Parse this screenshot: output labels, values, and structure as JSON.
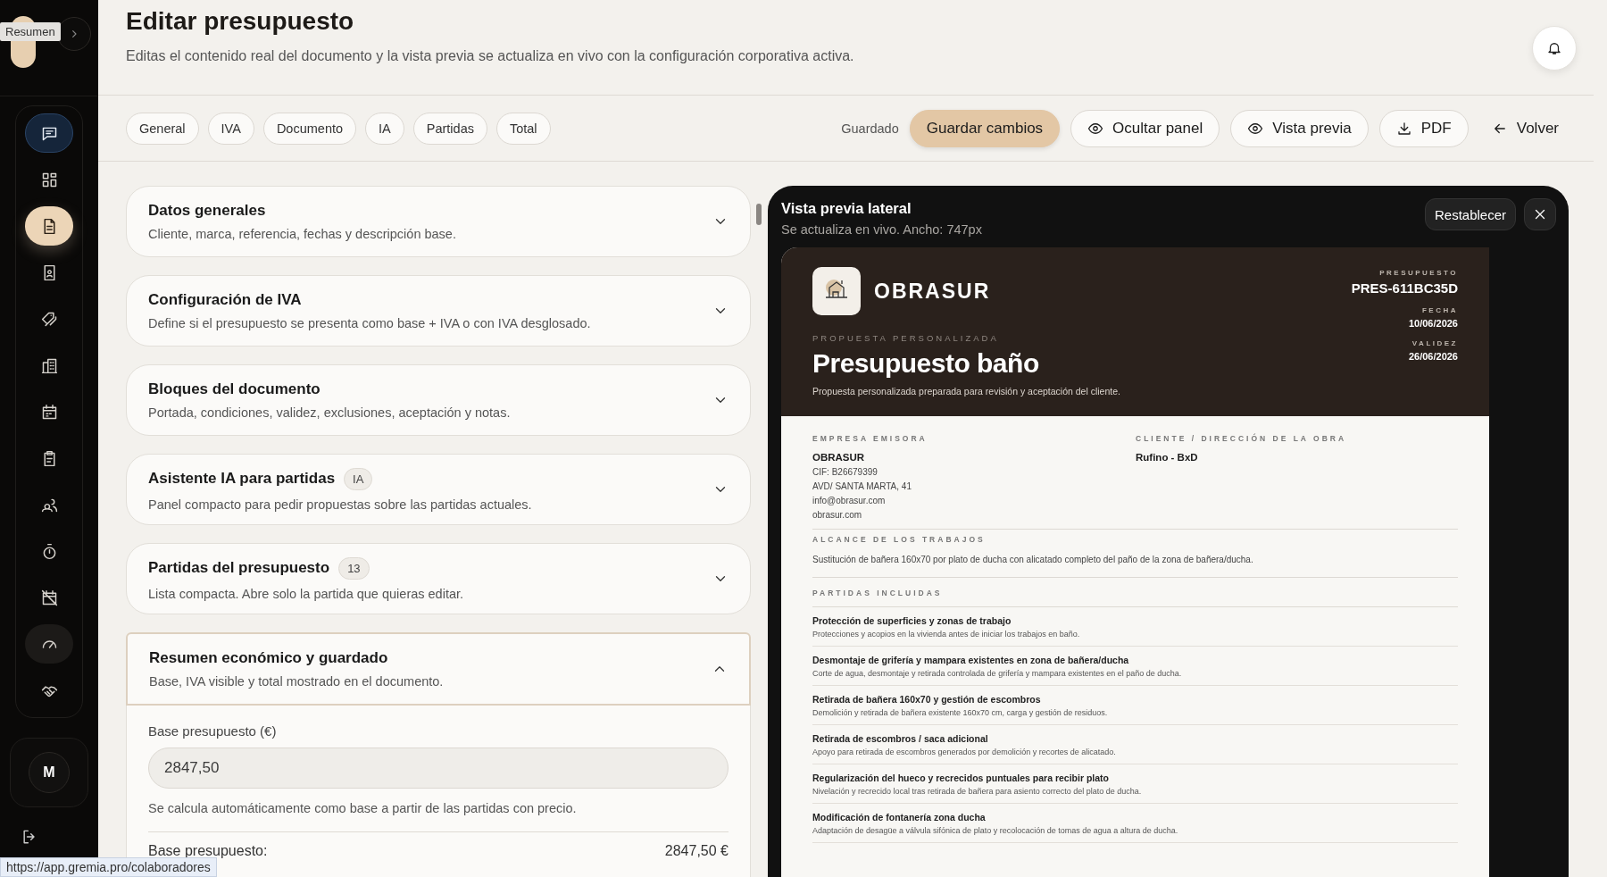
{
  "sidebar": {
    "tooltip": "Resumen",
    "nav": [
      {
        "selected": false,
        "active": true,
        "hovered": false
      },
      {
        "selected": false,
        "active": false,
        "hovered": false
      },
      {
        "selected": true,
        "active": false,
        "hovered": false
      },
      {
        "selected": false,
        "active": false,
        "hovered": false
      },
      {
        "selected": false,
        "active": false,
        "hovered": false
      },
      {
        "selected": false,
        "active": false,
        "hovered": false
      },
      {
        "selected": false,
        "active": false,
        "hovered": false
      },
      {
        "selected": false,
        "active": false,
        "hovered": false
      },
      {
        "selected": false,
        "active": false,
        "hovered": false
      },
      {
        "selected": false,
        "active": false,
        "hovered": false
      },
      {
        "selected": false,
        "active": false,
        "hovered": false
      },
      {
        "selected": false,
        "active": false,
        "hovered": true
      },
      {
        "selected": false,
        "active": false,
        "hovered": false
      }
    ],
    "avatar": "M"
  },
  "header": {
    "title": "Editar presupuesto",
    "subtitle": "Editas el contenido real del documento y la vista previa se actualiza en vivo con la configuración corporativa activa."
  },
  "section_tabs": [
    {
      "label": "General",
      "selected": false
    },
    {
      "label": "IVA",
      "selected": false
    },
    {
      "label": "Documento",
      "selected": false
    },
    {
      "label": "IA",
      "selected": false
    },
    {
      "label": "Partidas",
      "selected": false
    },
    {
      "label": "Total",
      "selected": false
    }
  ],
  "save_status": "Guardado",
  "actions": [
    {
      "label": "Guardar cambios",
      "kind": "primary"
    },
    {
      "label": "Ocultar panel",
      "kind": "eye"
    },
    {
      "label": "Vista previa",
      "kind": "eye"
    },
    {
      "label": "PDF",
      "kind": "download"
    },
    {
      "label": "Volver",
      "kind": "back"
    }
  ],
  "sections": [
    {
      "title": "Datos generales",
      "description": "Cliente, marca, referencia, fechas y descripción base.",
      "expanded": false
    },
    {
      "title": "Configuración de IVA",
      "description": "Define si el presupuesto se presenta como base + IVA o con IVA desglosado.",
      "expanded": false
    },
    {
      "title": "Bloques del documento",
      "description": "Portada, condiciones, validez, exclusiones, aceptación y notas.",
      "expanded": false
    },
    {
      "title": "Asistente IA para partidas",
      "badge": "IA",
      "description": "Panel compacto para pedir propuestas sobre las partidas actuales.",
      "expanded": false
    },
    {
      "title": "Partidas del presupuesto",
      "badge": "13",
      "description": "Lista compacta. Abre solo la partida que quieras editar.",
      "expanded": false
    },
    {
      "title": "Resumen económico y guardado",
      "description": "Base, IVA visible y total mostrado en el documento.",
      "expanded": true
    }
  ],
  "summary_form": {
    "field_label": "Base presupuesto (€)",
    "value": "2847,50",
    "help": "Se calcula automáticamente como base a partir de las partidas con precio.",
    "total_label": "Base presupuesto:",
    "total_value": "2847,50 €"
  },
  "preview": {
    "title": "Vista previa lateral",
    "subtitle": "Se actualiza en vivo. Ancho: 747px",
    "reset_label": "Restablecer",
    "document": {
      "company": "OBRASUR",
      "meta": [
        {
          "label": "PRESUPUESTO",
          "value": "PRES-611BC35D"
        },
        {
          "label": "FECHA",
          "value": "10/06/2026"
        },
        {
          "label": "VALIDEZ",
          "value": "26/06/2026"
        }
      ],
      "eyebrow": "PROPUESTA PERSONALIZADA",
      "title": "Presupuesto baño",
      "intro": "Propuesta personalizada preparada para revisión y aceptación del cliente.",
      "issuer": {
        "label": "EMPRESA EMISORA",
        "name": "OBRASUR",
        "lines": [
          "CIF: B26679399",
          "AVD/ SANTA MARTA, 41",
          "info@obrasur.com",
          "obrasur.com"
        ]
      },
      "client": {
        "label": "CLIENTE / DIRECCIÓN DE LA OBRA",
        "name": "Rufino - BxD"
      },
      "scope": {
        "label": "ALCANCE DE LOS TRABAJOS",
        "text": "Sustitución de bañera 160x70 por plato de ducha con alicatado completo del paño de la zona de bañera/ducha."
      },
      "items_label": "PARTIDAS INCLUIDAS",
      "items": [
        {
          "title": "Protección de superficies y zonas de trabajo",
          "description": "Protecciones y acopios en la vivienda antes de iniciar los trabajos en baño."
        },
        {
          "title": "Desmontaje de grifería y mampara existentes en zona de bañera/ducha",
          "description": "Corte de agua, desmontaje y retirada controlada de grifería y mampara existentes en el paño de ducha."
        },
        {
          "title": "Retirada de bañera 160x70 y gestión de escombros",
          "description": "Demolición y retirada de bañera existente 160x70 cm, carga y gestión de residuos."
        },
        {
          "title": "Retirada de escombros / saca adicional",
          "description": "Apoyo para retirada de escombros generados por demolición y recortes de alicatado."
        },
        {
          "title": "Regularización del hueco y recrecidos puntuales para recibir plato",
          "description": "Nivelación y recrecido local tras retirada de bañera para asiento correcto del plato de ducha."
        },
        {
          "title": "Modificación de fontanería zona ducha",
          "description": "Adaptación de desagüe a válvula sifónica de plato y recolocación de tomas de agua a altura de ducha."
        }
      ]
    }
  },
  "status_url": "https://app.gremia.pro/colaboradores"
}
